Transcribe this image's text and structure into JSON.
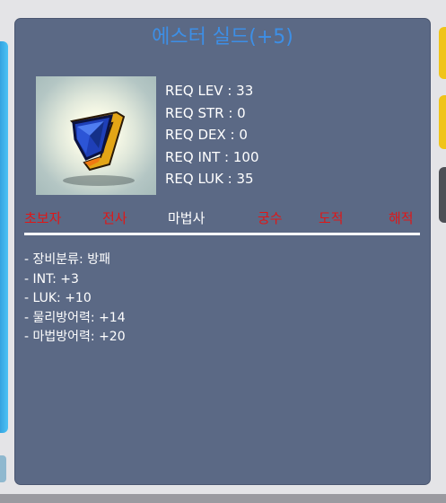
{
  "item": {
    "name": "에스터 실드(+5)",
    "icon": "blue-shield-icon"
  },
  "requirements": [
    "REQ LEV : 33",
    "REQ STR : 0",
    "REQ DEX : 0",
    "REQ INT : 100",
    "REQ LUK : 35"
  ],
  "jobs": [
    {
      "label": "초보자",
      "active": false
    },
    {
      "label": "전사",
      "active": false
    },
    {
      "label": "마법사",
      "active": true
    },
    {
      "label": "궁수",
      "active": false
    },
    {
      "label": "도적",
      "active": false
    },
    {
      "label": "해적",
      "active": false
    }
  ],
  "stats": [
    "- 장비분류: 방패",
    "- INT: +3",
    "- LUK: +10",
    "- 물리방어력: +14",
    "- 마법방어력: +20"
  ],
  "colors": {
    "panel_bg": "#5b6985",
    "title": "#3d8fe6",
    "job_unavailable": "#e01616",
    "job_available": "#ffffff"
  }
}
